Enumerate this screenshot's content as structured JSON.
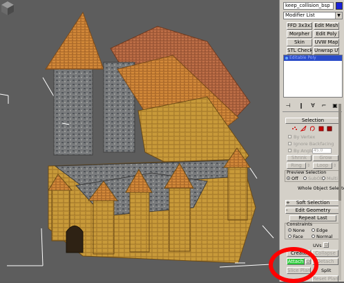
{
  "object_name": "keep_collision_bsp",
  "object_color": "#1a22d8",
  "modifier_list": "Modifier List",
  "modifier_buttons": [
    {
      "label": "FFD 3x3x3",
      "enabled": true
    },
    {
      "label": "Edit Mesh",
      "enabled": true
    },
    {
      "label": "Morpher",
      "enabled": true
    },
    {
      "label": "Edit Poly",
      "enabled": true
    },
    {
      "label": "Skin",
      "enabled": true
    },
    {
      "label": "UVW Map",
      "enabled": true
    },
    {
      "label": "STL Check",
      "enabled": true
    },
    {
      "label": "Unwrap UVW",
      "enabled": true
    }
  ],
  "stack": {
    "selected_item": "Editable Poly"
  },
  "stack_tool_icons": [
    "pin-stack-icon",
    "show-end-result-icon",
    "make-unique-icon",
    "remove-modifier-icon",
    "configure-modifier-sets-icon"
  ],
  "selection_rollout": {
    "title": "Selection",
    "level_icons": [
      "vertex-level-icon",
      "edge-level-icon",
      "border-level-icon",
      "polygon-level-icon",
      "element-level-icon"
    ],
    "by_vertex": "By Vertex",
    "ignore_backfacing": "Ignore Backfacing",
    "by_angle": "By Angle:",
    "by_angle_value": "45.0",
    "shrink": "Shrink",
    "grow": "Grow",
    "ring": "Ring",
    "loop": "Loop",
    "preview_selection": "Preview Selection",
    "preview_options": [
      "Off",
      "SubObj",
      "Multi"
    ],
    "preview_selected": "Off",
    "status": "Whole Object Selected"
  },
  "soft_selection_rollout": {
    "title": "Soft Selection"
  },
  "edit_geometry_rollout": {
    "title": "Edit Geometry",
    "repeat_last": "Repeat Last",
    "constraints": "Constraints",
    "constraint_options": [
      "None",
      "Edge",
      "Face",
      "Normal"
    ],
    "constraint_selected": "None",
    "preserve_uvs": "UVs",
    "create": "Create",
    "collapse": "Collapse",
    "attach": "Attach",
    "detach": "Detach",
    "slice_plane": "Slice Plane",
    "split": "Split",
    "reset_plane": "Reset Plane"
  },
  "annotation": {
    "color": "#ff0000",
    "target": "Attach"
  }
}
